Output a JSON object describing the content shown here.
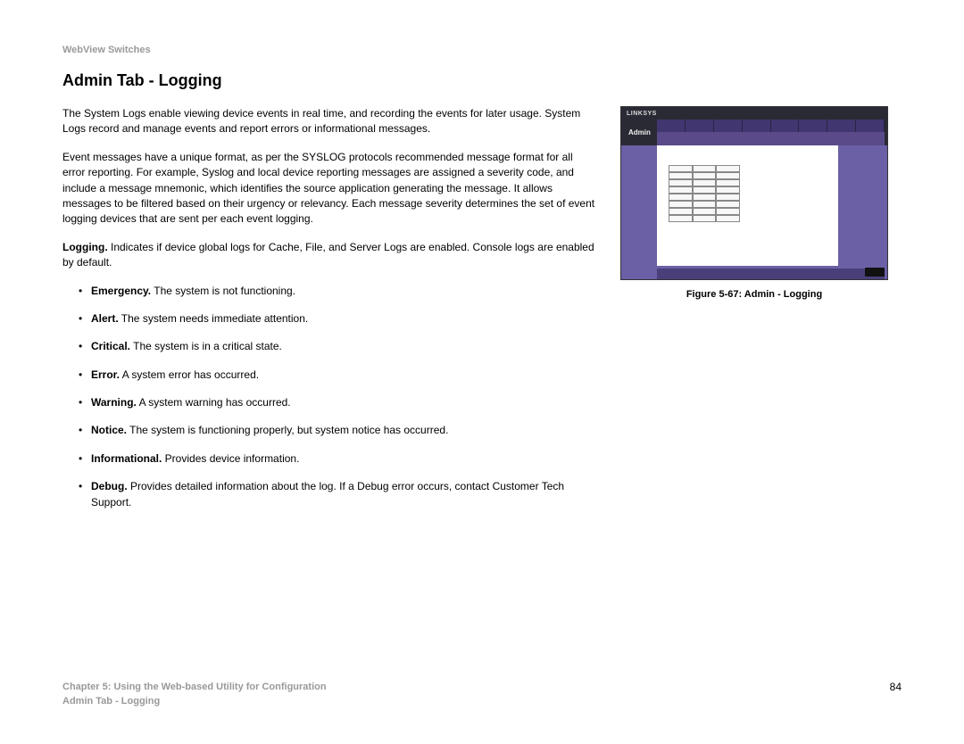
{
  "header": {
    "product": "WebView Switches"
  },
  "title": "Admin Tab - Logging",
  "paragraphs": {
    "p1": "The System Logs enable viewing device events in real time, and recording the events for later usage. System Logs record and manage events and report errors or informational messages.",
    "p2": "Event messages have a unique format, as per the SYSLOG protocols recommended message format for all error reporting. For example, Syslog and local device reporting messages are assigned a severity code, and include a message mnemonic, which identifies the source application generating the message. It allows messages to be filtered based on their urgency or relevancy. Each message severity determines the set of event logging devices that are sent per each event logging.",
    "p3_term": "Logging.",
    "p3_rest": " Indicates if device global logs for Cache, File, and Server Logs are enabled. Console logs are enabled by default."
  },
  "bullets": [
    {
      "term": "Emergency.",
      "desc": " The system is not functioning."
    },
    {
      "term": "Alert.",
      "desc": " The system needs immediate attention."
    },
    {
      "term": "Critical.",
      "desc": " The system is in a critical state."
    },
    {
      "term": "Error.",
      "desc": " A system error has occurred."
    },
    {
      "term": "Warning.",
      "desc": " A system warning has occurred."
    },
    {
      "term": "Notice.",
      "desc": " The system is functioning properly, but system notice has occurred."
    },
    {
      "term": "Informational.",
      "desc": " Provides device information."
    },
    {
      "term": "Debug.",
      "desc": " Provides detailed information about the log. If a Debug error occurs, contact Customer Tech Support."
    }
  ],
  "figure": {
    "caption": "Figure 5-67: Admin - Logging",
    "brand": "LINKSYS"
  },
  "footer": {
    "line1": "Chapter 5: Using the Web-based Utility for Configuration",
    "line2": "Admin Tab - Logging",
    "page": "84"
  }
}
